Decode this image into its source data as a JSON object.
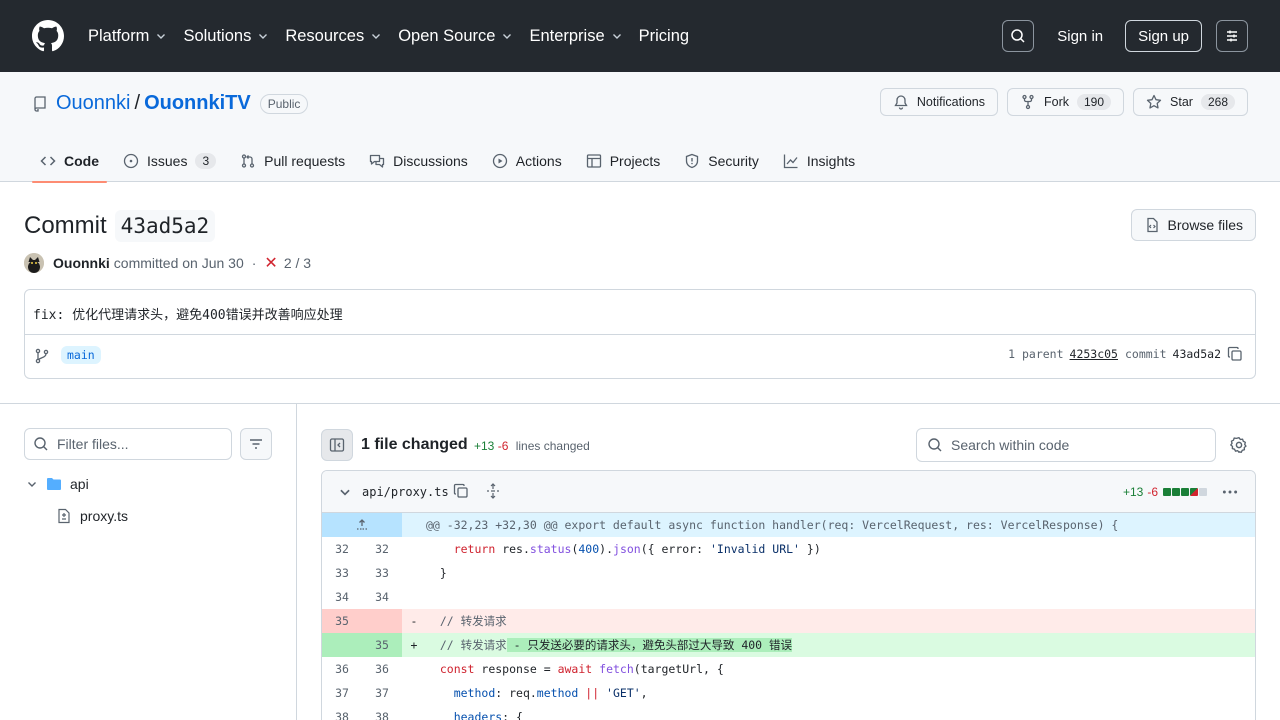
{
  "header": {
    "nav": [
      "Platform",
      "Solutions",
      "Resources",
      "Open Source",
      "Enterprise",
      "Pricing"
    ],
    "sign_in": "Sign in",
    "sign_up": "Sign up"
  },
  "repo": {
    "owner": "Ouonnki",
    "separator": "/",
    "name": "OuonnkiTV",
    "visibility": "Public",
    "notifications_label": "Notifications",
    "fork_label": "Fork",
    "fork_count": "190",
    "star_label": "Star",
    "star_count": "268",
    "tabs": [
      {
        "label": "Code",
        "icon": "code-icon"
      },
      {
        "label": "Issues",
        "icon": "issue-icon",
        "count": "3"
      },
      {
        "label": "Pull requests",
        "icon": "pull-request-icon"
      },
      {
        "label": "Discussions",
        "icon": "discussions-icon"
      },
      {
        "label": "Actions",
        "icon": "play-icon"
      },
      {
        "label": "Projects",
        "icon": "table-icon"
      },
      {
        "label": "Security",
        "icon": "shield-icon"
      },
      {
        "label": "Insights",
        "icon": "graph-icon"
      }
    ]
  },
  "commit": {
    "title_prefix": "Commit",
    "sha": "43ad5a2",
    "browse_files": "Browse files",
    "author": "Ouonnki",
    "committed_on": "committed on Jun 30",
    "dot": "·",
    "checks": "2 / 3",
    "message": "fix: 优化代理请求头，避免400错误并改善响应处理",
    "branch": "main",
    "parent_prefix": "1 parent",
    "parent_sha": "4253c05",
    "commit_label": "commit",
    "commit_sha": "43ad5a2"
  },
  "sidebar": {
    "filter_placeholder": "Filter files...",
    "folder": "api",
    "file": "proxy.ts"
  },
  "diff": {
    "files_changed": "1 file changed",
    "additions": "+13",
    "deletions": "-6",
    "lines_changed": "lines changed",
    "search_placeholder": "Search within code",
    "file_name": "api/proxy.ts",
    "file_additions": "+13",
    "file_deletions": "-6",
    "hunk": "@@ -32,23 +32,30 @@ export default async function handler(req: VercelRequest, res: VercelResponse) {",
    "rows": [
      {
        "old": "32",
        "new": "32",
        "sign": "",
        "type": "ctx"
      },
      {
        "old": "33",
        "new": "33",
        "sign": "",
        "type": "ctx"
      },
      {
        "old": "34",
        "new": "34",
        "sign": "",
        "type": "ctx"
      },
      {
        "old": "35",
        "new": "",
        "sign": "-",
        "type": "del"
      },
      {
        "old": "",
        "new": "35",
        "sign": "+",
        "type": "add"
      },
      {
        "old": "36",
        "new": "36",
        "sign": "",
        "type": "ctx"
      },
      {
        "old": "37",
        "new": "37",
        "sign": "",
        "type": "ctx"
      },
      {
        "old": "38",
        "new": "38",
        "sign": "",
        "type": "ctx"
      }
    ],
    "code": {
      "l32_return": "return",
      "l32_res": "res.",
      "l32_status": "status",
      "l32_p1": "(",
      "l32_400": "400",
      "l32_p2": ").",
      "l32_json": "json",
      "l32_p3": "({ error: ",
      "l32_str": "'Invalid URL'",
      "l32_p4": " })",
      "l33": "}",
      "l35_del": "// 转发请求",
      "l35_add_a": "// 转发请求",
      "l35_add_b": " - 只发送必要的请求头，避免头部过大导致 400 错误",
      "l36_const": "const",
      "l36_var": " response = ",
      "l36_await": "await",
      "l36_fetch": "fetch",
      "l36_rest": "(targetUrl, {",
      "l37_key": "method",
      "l37_mid": ": req.",
      "l37_prop": "method",
      "l37_op": " || ",
      "l37_str": "'GET'",
      "l37_end": ",",
      "l38_key": "headers",
      "l38_end": ": {"
    }
  },
  "colors": {
    "header_bg": "#24292f",
    "link": "#0969da",
    "add": "#1a7f37",
    "del": "#d1242f",
    "tab_underline": "#fd8c73"
  }
}
